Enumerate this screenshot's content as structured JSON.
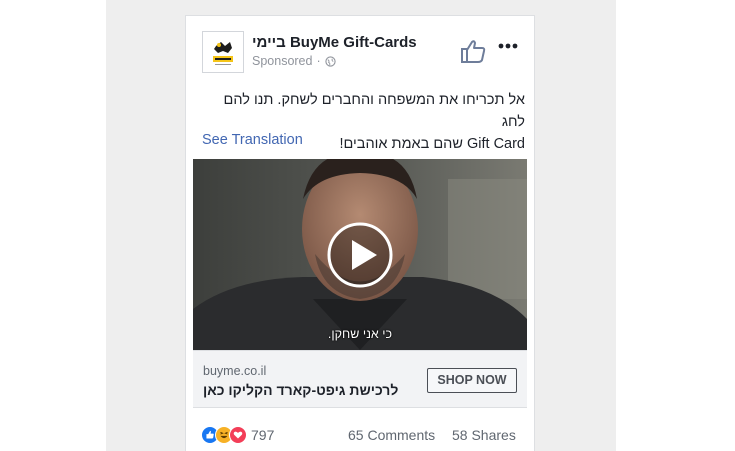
{
  "post": {
    "page_name": "ביימי BuyMe Gift-Cards",
    "sponsored": "Sponsored",
    "text_line1": "אל תכריחו את המשפחה והחברים לשחק. תנו להם לחג",
    "text_line2": "Gift Card שהם באמת אוהבים!",
    "see_translation": "See Translation"
  },
  "video": {
    "subtitle": "כי אני שחקן."
  },
  "cta": {
    "domain": "buyme.co.il",
    "headline": "לרכישת גיפט-קארד הקליקו כאן",
    "button_label": "SHOP NOW"
  },
  "engagement": {
    "reaction_count": "797",
    "comments": "65 Comments",
    "shares": "58 Shares"
  },
  "icons": {
    "like": "thumbs-up-icon",
    "more": "more-options-icon",
    "globe": "globe-icon",
    "play": "play-icon"
  },
  "colors": {
    "link": "#4267b2",
    "like_reaction": "#1877f2",
    "haha_reaction": "#f7b125",
    "love_reaction": "#f33e58"
  }
}
